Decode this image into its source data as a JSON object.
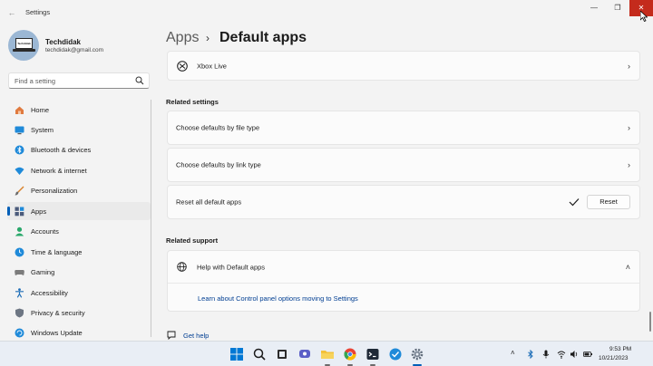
{
  "window": {
    "title": "Settings",
    "back_glyph": "←",
    "minimize_glyph": "—",
    "maximize_glyph": "❐",
    "close_glyph": "✕"
  },
  "profile": {
    "name": "Techdidak",
    "email": "techdidak@gmail.com",
    "avatar_text": "Techdidak"
  },
  "search": {
    "placeholder": "Find a setting"
  },
  "sidebar": {
    "items": [
      {
        "label": "Home",
        "icon": "home-icon"
      },
      {
        "label": "System",
        "icon": "system-icon"
      },
      {
        "label": "Bluetooth & devices",
        "icon": "bluetooth-icon"
      },
      {
        "label": "Network & internet",
        "icon": "wifi-icon"
      },
      {
        "label": "Personalization",
        "icon": "brush-icon"
      },
      {
        "label": "Apps",
        "icon": "apps-icon",
        "active": true
      },
      {
        "label": "Accounts",
        "icon": "accounts-icon"
      },
      {
        "label": "Time & language",
        "icon": "globe-clock-icon"
      },
      {
        "label": "Gaming",
        "icon": "gamepad-icon"
      },
      {
        "label": "Accessibility",
        "icon": "accessibility-icon"
      },
      {
        "label": "Privacy & security",
        "icon": "shield-icon"
      },
      {
        "label": "Windows Update",
        "icon": "update-icon"
      }
    ]
  },
  "breadcrumb": {
    "parent": "Apps",
    "separator": "›",
    "current": "Default apps"
  },
  "main": {
    "xbox_row": {
      "label": "Xbox Live"
    },
    "related_settings": {
      "title": "Related settings",
      "file_type": "Choose defaults by file type",
      "link_type": "Choose defaults by link type",
      "reset_label": "Reset all default apps",
      "reset_button": "Reset"
    },
    "related_support": {
      "title": "Related support",
      "help_title": "Help with Default apps",
      "help_link": "Learn about Control panel options moving to Settings"
    },
    "get_help": "Get help",
    "chevron": "›",
    "chevron_up": "˄"
  },
  "taskbar": {
    "time": "9:53 PM",
    "date": "10/21/2023",
    "tray_chevron": "˄"
  },
  "colors": {
    "accent": "#005fb8",
    "close": "#c42b1c",
    "link": "#003e92"
  }
}
